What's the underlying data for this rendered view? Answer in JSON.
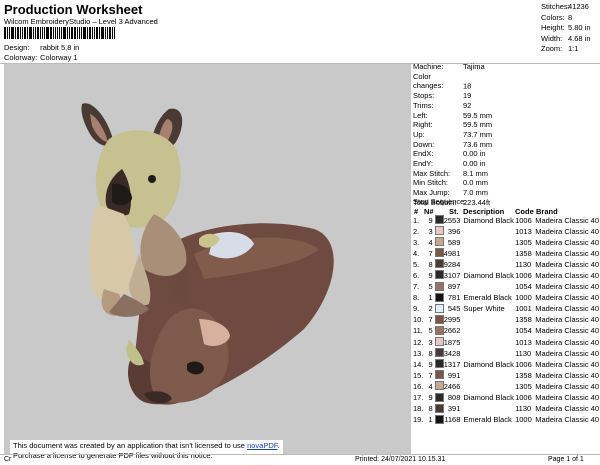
{
  "header": {
    "title": "Production Worksheet",
    "subtitle": "Wilcom EmbroideryStudio – Level 3 Advanced",
    "design_label": "Design:",
    "design_value": "rabbit 5,8 in",
    "colorway_label": "Colorway:",
    "colorway_value": "Colorway 1"
  },
  "stats": [
    {
      "label": "Stitches:",
      "value": "41236"
    },
    {
      "label": "Colors:",
      "value": "8"
    },
    {
      "label": "Height:",
      "value": "5.80 in"
    },
    {
      "label": "Width:",
      "value": "4.68 in"
    },
    {
      "label": "Zoom:",
      "value": "1:1"
    }
  ],
  "machine_info": [
    {
      "label": "Machine:",
      "value": "Tajima"
    },
    {
      "label": "Color changes:",
      "value": "18"
    },
    {
      "label": "Stops:",
      "value": "19"
    },
    {
      "label": "Trims:",
      "value": "92"
    },
    {
      "label": "Left:",
      "value": "59.5 mm"
    },
    {
      "label": "Right:",
      "value": "59.5 mm"
    },
    {
      "label": "Up:",
      "value": "73.7 mm"
    },
    {
      "label": "Down:",
      "value": "73.6 mm"
    },
    {
      "label": "EndX:",
      "value": "0.00 in"
    },
    {
      "label": "EndY:",
      "value": "0.00 in"
    },
    {
      "label": "Max Stitch:",
      "value": "8.1 mm"
    },
    {
      "label": "Min Stitch:",
      "value": "0.0 mm"
    },
    {
      "label": "Max Jump:",
      "value": "7.0 mm"
    },
    {
      "label": "Total Bobbin:",
      "value": "223.44ft"
    }
  ],
  "stop_sequence": {
    "title": "Stop Sequence:",
    "headers": [
      "#",
      "N#",
      "St.",
      "Description",
      "Code",
      "Brand"
    ],
    "rows": [
      {
        "num": "1.",
        "n": "9",
        "color": "#2a2a2a",
        "st": "2553",
        "desc": "Diamond Black",
        "code": "1006",
        "brand": "Madeira Classic 40"
      },
      {
        "num": "2.",
        "n": "3",
        "color": "#e8c8c0",
        "st": "396",
        "desc": "",
        "code": "1013",
        "brand": "Madeira Classic 40"
      },
      {
        "num": "3.",
        "n": "4",
        "color": "#c8a890",
        "st": "589",
        "desc": "",
        "code": "1305",
        "brand": "Madeira Classic 40"
      },
      {
        "num": "4.",
        "n": "7",
        "color": "#7a5548",
        "st": "4981",
        "desc": "",
        "code": "1358",
        "brand": "Madeira Classic 40"
      },
      {
        "num": "5.",
        "n": "8",
        "color": "#4a3a38",
        "st": "9284",
        "desc": "",
        "code": "1130",
        "brand": "Madeira Classic 40"
      },
      {
        "num": "6.",
        "n": "9",
        "color": "#2a2a2a",
        "st": "3107",
        "desc": "Diamond Black",
        "code": "1006",
        "brand": "Madeira Classic 40"
      },
      {
        "num": "7.",
        "n": "5",
        "color": "#9a7264",
        "st": "897",
        "desc": "",
        "code": "1054",
        "brand": "Madeira Classic 40"
      },
      {
        "num": "8.",
        "n": "1",
        "color": "#141414",
        "st": "781",
        "desc": "Emerald Black",
        "code": "1000",
        "brand": "Madeira Classic 40"
      },
      {
        "num": "9.",
        "n": "2",
        "color": "#e4eef8",
        "st": "545",
        "desc": "Super White",
        "code": "1001",
        "brand": "Madeira Classic 40"
      },
      {
        "num": "10.",
        "n": "7",
        "color": "#7a5548",
        "st": "2995",
        "desc": "",
        "code": "1358",
        "brand": "Madeira Classic 40"
      },
      {
        "num": "11.",
        "n": "5",
        "color": "#9a7264",
        "st": "2662",
        "desc": "",
        "code": "1054",
        "brand": "Madeira Classic 40"
      },
      {
        "num": "12.",
        "n": "3",
        "color": "#e8c8c0",
        "st": "1875",
        "desc": "",
        "code": "1013",
        "brand": "Madeira Classic 40"
      },
      {
        "num": "13.",
        "n": "8",
        "color": "#4a3a38",
        "st": "3428",
        "desc": "",
        "code": "1130",
        "brand": "Madeira Classic 40"
      },
      {
        "num": "14.",
        "n": "9",
        "color": "#2a2a2a",
        "st": "1317",
        "desc": "Diamond Black",
        "code": "1006",
        "brand": "Madeira Classic 40"
      },
      {
        "num": "15.",
        "n": "7",
        "color": "#7a5548",
        "st": "991",
        "desc": "",
        "code": "1358",
        "brand": "Madeira Classic 40"
      },
      {
        "num": "16.",
        "n": "4",
        "color": "#c8a890",
        "st": "2466",
        "desc": "",
        "code": "1305",
        "brand": "Madeira Classic 40"
      },
      {
        "num": "17.",
        "n": "9",
        "color": "#2a2a2a",
        "st": "808",
        "desc": "Diamond Black",
        "code": "1006",
        "brand": "Madeira Classic 40"
      },
      {
        "num": "18.",
        "n": "8",
        "color": "#4a3a38",
        "st": "391",
        "desc": "",
        "code": "1130",
        "brand": "Madeira Classic 40"
      },
      {
        "num": "19.",
        "n": "1",
        "color": "#141414",
        "st": "1168",
        "desc": "Emerald Black",
        "code": "1000",
        "brand": "Madeira Classic 40"
      }
    ]
  },
  "notice": {
    "line1_pre": "This document was created by an application that isn't licensed to use ",
    "link": "novaPDF",
    "line1_post": ".",
    "line2": "Purchase a license to generate PDF files without this notice."
  },
  "footer": {
    "left": "Cr",
    "printed": "Printed: 24/07/2021 10.15.31",
    "page": "Page 1 of 1"
  }
}
